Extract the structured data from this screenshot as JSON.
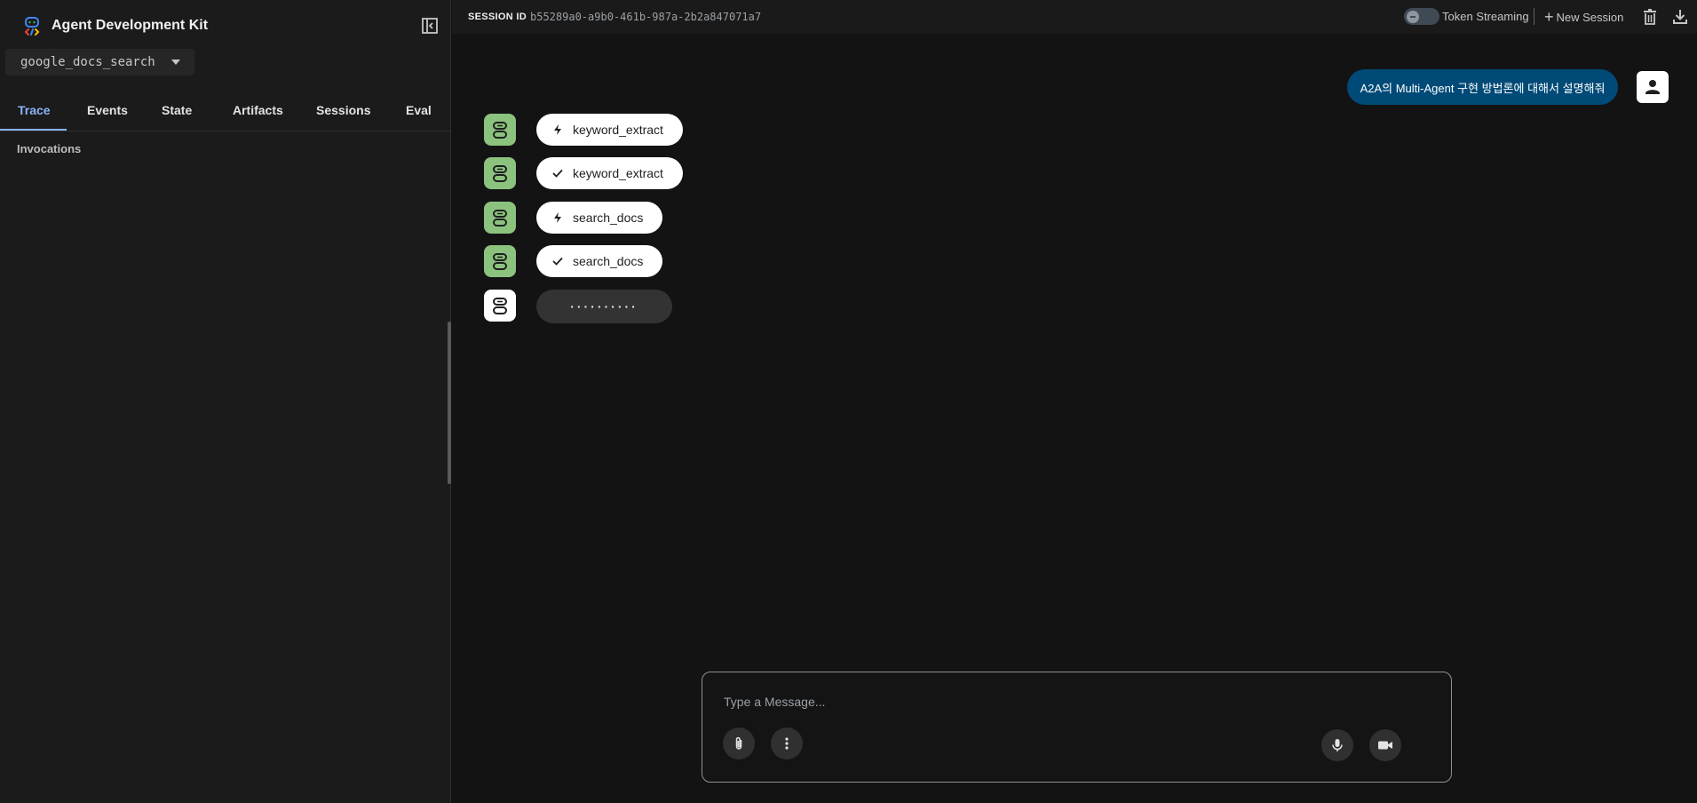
{
  "app": {
    "title": "Agent Development Kit"
  },
  "sidebar": {
    "selected_agent": "google_docs_search",
    "tabs": [
      {
        "label": "Trace",
        "active": true
      },
      {
        "label": "Events",
        "active": false
      },
      {
        "label": "State",
        "active": false
      },
      {
        "label": "Artifacts",
        "active": false
      },
      {
        "label": "Sessions",
        "active": false
      },
      {
        "label": "Eval",
        "active": false
      }
    ],
    "section_label": "Invocations"
  },
  "topbar": {
    "session_label": "SESSION ID",
    "session_id": "b55289a0-a9b0-461b-987a-2b2a847071a7",
    "token_streaming_label": "Token Streaming",
    "token_streaming_on": false,
    "new_session_label": "New Session"
  },
  "chat": {
    "user_message": "A2A의 Multi-Agent 구현 방법론에 대해서 설명해줘",
    "events": [
      {
        "kind": "function_call",
        "icon": "bolt-icon",
        "name": "keyword_extract"
      },
      {
        "kind": "function_response",
        "icon": "check-icon",
        "name": "keyword_extract"
      },
      {
        "kind": "function_call",
        "icon": "bolt-icon",
        "name": "search_docs"
      },
      {
        "kind": "function_response",
        "icon": "check-icon",
        "name": "search_docs"
      }
    ],
    "loading_indicator": "··········"
  },
  "composer": {
    "placeholder": "Type a Message..."
  },
  "colors": {
    "accent": "#8ab4f8",
    "user_bubble": "#004a77",
    "bot_avatar": "#8bc37e"
  }
}
